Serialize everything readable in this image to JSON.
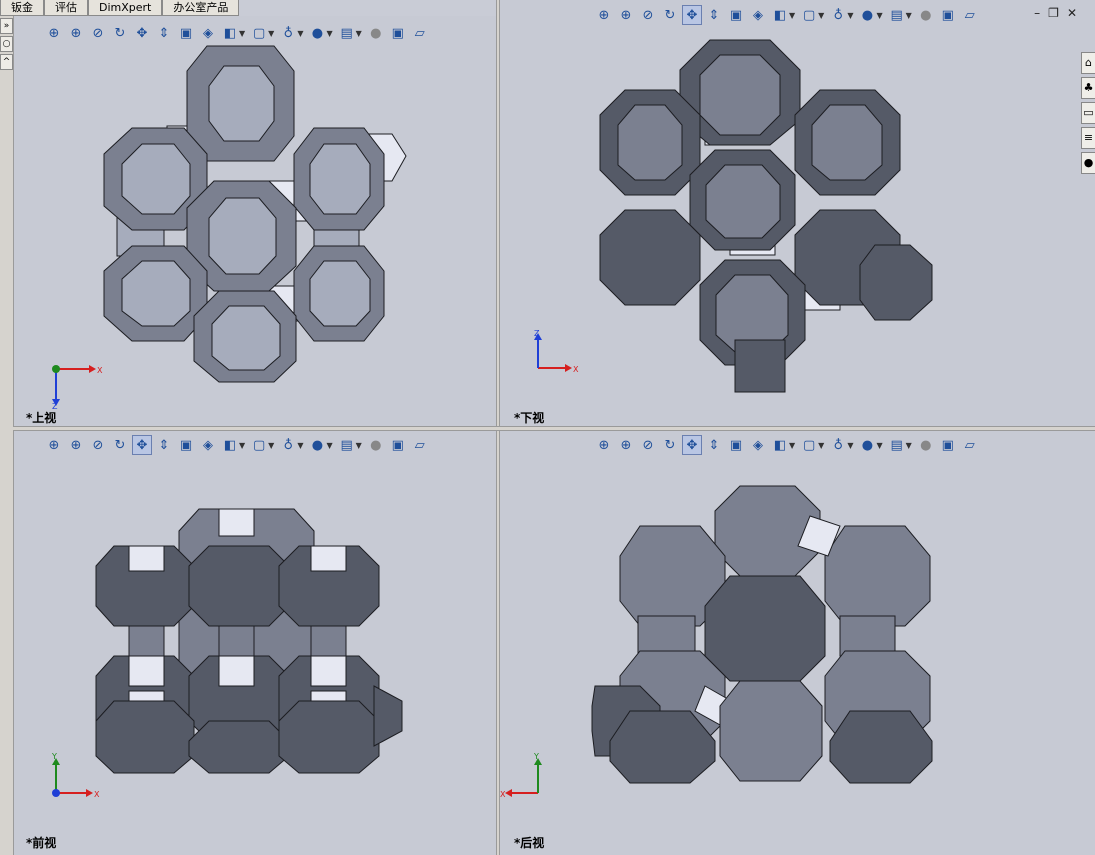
{
  "tabs": [
    {
      "label": "钣金"
    },
    {
      "label": "评估"
    },
    {
      "label": "DimXpert"
    },
    {
      "label": "办公室产品"
    }
  ],
  "toolbar_icons": [
    "zoom-to-fit-icon",
    "zoom-to-area-icon",
    "zoom-in-out-icon",
    "rotate-icon",
    "pan-icon",
    "roll-icon",
    "previous-view-icon",
    "view-orientation-icon",
    "section-view-icon",
    "display-style-icon",
    "hide-show-icon",
    "edit-appearance-icon",
    "apply-scene-icon",
    "view-settings-icon",
    "realview-icon",
    "shadows-icon",
    "perspective-icon"
  ],
  "viewports": [
    {
      "id": "top",
      "label": "*上视",
      "triad": {
        "a": "X",
        "b": "Z"
      }
    },
    {
      "id": "bottom",
      "label": "*下视",
      "triad": {
        "a": "X",
        "b": "Z"
      }
    },
    {
      "id": "front",
      "label": "*前视",
      "triad": {
        "a": "X",
        "b": "Y"
      }
    },
    {
      "id": "back",
      "label": "*后视",
      "triad": {
        "a": "X",
        "b": "Y"
      }
    }
  ],
  "window_controls": {
    "minimize": "–",
    "restore": "❐",
    "close": "✕"
  },
  "colors": {
    "background": "#c7cad4",
    "face_light": "#a6acbc",
    "face_mid": "#7b8090",
    "face_dark": "#555a67",
    "face_highlight": "#e6e8f2",
    "edge": "#1c1d22",
    "axis_x": "#d61f1f",
    "axis_y": "#1e8a1e",
    "axis_z": "#1f3fd6"
  }
}
